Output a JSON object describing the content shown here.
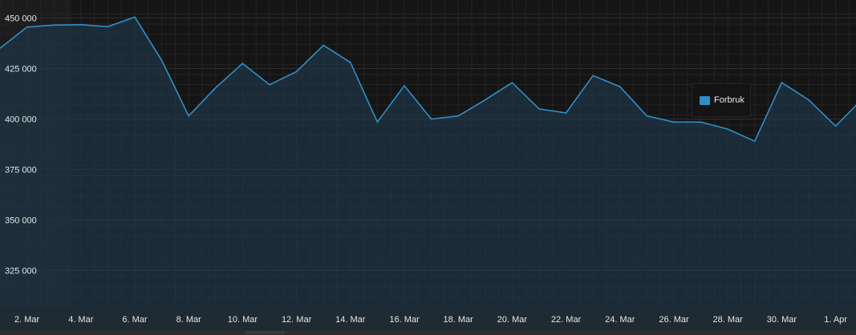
{
  "chart_data": {
    "type": "area",
    "title": "",
    "xlabel": "",
    "ylabel": "",
    "legend": {
      "position": "right",
      "entries": [
        "Forbruk"
      ]
    },
    "grid": true,
    "x": [
      "1. Mar",
      "2. Mar",
      "3. Mar",
      "4. Mar",
      "5. Mar",
      "6. Mar",
      "7. Mar",
      "8. Mar",
      "9. Mar",
      "10. Mar",
      "11. Mar",
      "12. Mar",
      "13. Mar",
      "14. Mar",
      "15. Mar",
      "16. Mar",
      "17. Mar",
      "18. Mar",
      "19. Mar",
      "20. Mar",
      "21. Mar",
      "22. Mar",
      "23. Mar",
      "24. Mar",
      "25. Mar",
      "26. Mar",
      "27. Mar",
      "28. Mar",
      "29. Mar",
      "30. Mar",
      "31. Mar",
      "1. Apr",
      "2. Apr"
    ],
    "x_tick_labels": [
      "2. Mar",
      "4. Mar",
      "6. Mar",
      "8. Mar",
      "10. Mar",
      "12. Mar",
      "14. Mar",
      "16. Mar",
      "18. Mar",
      "20. Mar",
      "22. Mar",
      "24. Mar",
      "26. Mar",
      "28. Mar",
      "30. Mar",
      "1. Apr"
    ],
    "y_tick_labels": [
      "450 000",
      "425 000",
      "400 000",
      "375 000",
      "350 000",
      "325 000"
    ],
    "ylim": [
      307000,
      452000
    ],
    "series": [
      {
        "name": "Forbruk",
        "color": "#2f8fc9",
        "values": [
          435000,
          445500,
          446500,
          446700,
          445700,
          450500,
          429000,
          401500,
          415500,
          427500,
          417000,
          423500,
          436500,
          428000,
          398500,
          416500,
          400000,
          401500,
          409500,
          418000,
          405000,
          403000,
          421500,
          416000,
          401500,
          398500,
          398500,
          395000,
          389000,
          418000,
          409500,
          396500,
          410000
        ]
      }
    ]
  }
}
